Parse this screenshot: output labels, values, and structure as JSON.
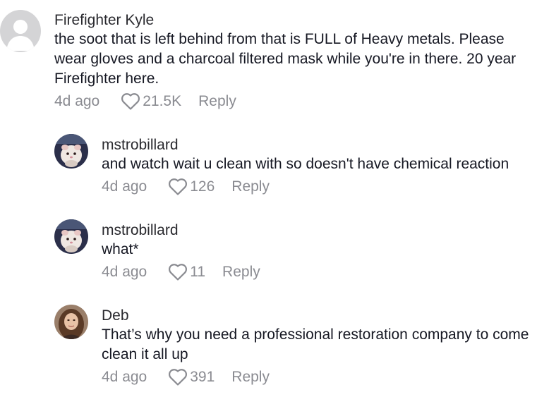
{
  "comments": [
    {
      "username": "Firefighter Kyle",
      "avatar_icon": "default-user-avatar",
      "text": "the soot that is left behind from that is FULL of Heavy metals. Please\nwear gloves and a charcoal filtered mask while you're in there. 20 year\nFirefighter here.",
      "time": "4d ago",
      "likes": "21.5K",
      "reply_label": "Reply"
    },
    {
      "username": "mstrobillard",
      "avatar_icon": "hamster-photo-avatar",
      "text": "and watch wait u clean with so doesn't have chemical reaction",
      "time": "4d ago",
      "likes": "126",
      "reply_label": "Reply"
    },
    {
      "username": "mstrobillard",
      "avatar_icon": "hamster-photo-avatar",
      "text": "what*",
      "time": "4d ago",
      "likes": "11",
      "reply_label": "Reply"
    },
    {
      "username": "Deb",
      "avatar_icon": "woman-photo-avatar",
      "text": "That’s why you need a professional restoration company to come\nclean it all up",
      "time": "4d ago",
      "likes": "391",
      "reply_label": "Reply"
    }
  ],
  "colors": {
    "text": "#161823",
    "username": "#2a2a2f",
    "meta": "#8a8b91",
    "default_avatar_bg": "#d4d4d6"
  }
}
